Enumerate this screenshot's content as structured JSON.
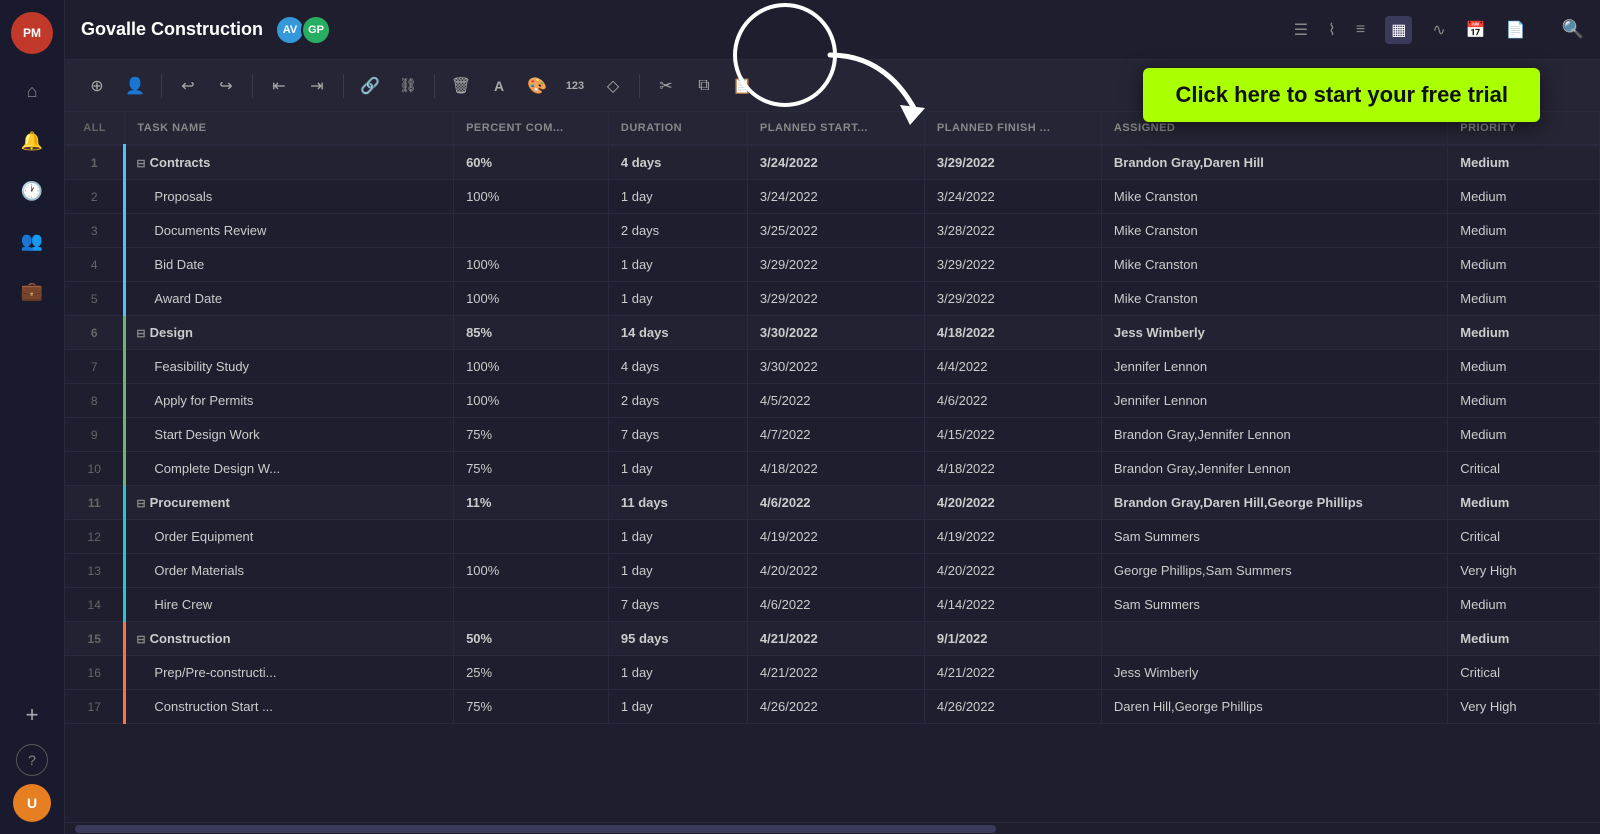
{
  "app": {
    "logo_text": "PM",
    "title": "Govalle Construction",
    "avatar1_text": "AV",
    "avatar2_text": "GP",
    "search_icon": "🔍",
    "free_trial_text": "Click here to start your free trial"
  },
  "sidebar": {
    "items": [
      {
        "id": "home",
        "icon": "⌂",
        "label": "Home"
      },
      {
        "id": "notifications",
        "icon": "🔔",
        "label": "Notifications"
      },
      {
        "id": "time",
        "icon": "🕐",
        "label": "Time"
      },
      {
        "id": "team",
        "icon": "👥",
        "label": "Team"
      },
      {
        "id": "portfolio",
        "icon": "💼",
        "label": "Portfolio"
      },
      {
        "id": "add",
        "icon": "+",
        "label": "Add"
      },
      {
        "id": "help",
        "icon": "?",
        "label": "Help"
      }
    ]
  },
  "toolbar": {
    "buttons": [
      {
        "id": "add-task",
        "icon": "⊕",
        "label": "Add Task"
      },
      {
        "id": "add-person",
        "icon": "👤",
        "label": "Add Person"
      },
      {
        "id": "undo",
        "icon": "↩",
        "label": "Undo"
      },
      {
        "id": "redo",
        "icon": "↪",
        "label": "Redo"
      },
      {
        "id": "indent-left",
        "icon": "⇤",
        "label": "Indent Left"
      },
      {
        "id": "indent-right",
        "icon": "⇥",
        "label": "Indent Right"
      },
      {
        "id": "link",
        "icon": "🔗",
        "label": "Link"
      },
      {
        "id": "unlink",
        "icon": "⛓",
        "label": "Unlink"
      },
      {
        "id": "delete",
        "icon": "🗑",
        "label": "Delete"
      },
      {
        "id": "font",
        "icon": "A",
        "label": "Font"
      },
      {
        "id": "color",
        "icon": "🎨",
        "label": "Color"
      },
      {
        "id": "number",
        "icon": "123",
        "label": "Number"
      },
      {
        "id": "shape",
        "icon": "◇",
        "label": "Shape"
      },
      {
        "id": "cut",
        "icon": "✂",
        "label": "Cut"
      },
      {
        "id": "copy",
        "icon": "⧉",
        "label": "Copy"
      },
      {
        "id": "paste",
        "icon": "📋",
        "label": "Paste"
      }
    ]
  },
  "table": {
    "headers": [
      {
        "id": "all",
        "label": "ALL"
      },
      {
        "id": "task-name",
        "label": "TASK NAME"
      },
      {
        "id": "percent",
        "label": "PERCENT COM..."
      },
      {
        "id": "duration",
        "label": "DURATION"
      },
      {
        "id": "planned-start",
        "label": "PLANNED START..."
      },
      {
        "id": "planned-finish",
        "label": "PLANNED FINISH ..."
      },
      {
        "id": "assigned",
        "label": "ASSIGNED"
      },
      {
        "id": "priority",
        "label": "PRIORITY"
      }
    ],
    "rows": [
      {
        "num": 1,
        "type": "group",
        "color": "blue",
        "name": "Contracts",
        "percent": "60%",
        "duration": "4 days",
        "start": "3/24/2022",
        "finish": "3/29/2022",
        "assigned": "Brandon Gray,Daren Hill",
        "priority": "Medium"
      },
      {
        "num": 2,
        "type": "task",
        "color": "blue",
        "name": "Proposals",
        "percent": "100%",
        "duration": "1 day",
        "start": "3/24/2022",
        "finish": "3/24/2022",
        "assigned": "Mike Cranston",
        "priority": "Medium"
      },
      {
        "num": 3,
        "type": "task",
        "color": "blue",
        "name": "Documents Review",
        "percent": "",
        "duration": "2 days",
        "start": "3/25/2022",
        "finish": "3/28/2022",
        "assigned": "Mike Cranston",
        "priority": "Medium"
      },
      {
        "num": 4,
        "type": "task",
        "color": "blue",
        "name": "Bid Date",
        "percent": "100%",
        "duration": "1 day",
        "start": "3/29/2022",
        "finish": "3/29/2022",
        "assigned": "Mike Cranston",
        "priority": "Medium"
      },
      {
        "num": 5,
        "type": "task",
        "color": "blue",
        "name": "Award Date",
        "percent": "100%",
        "duration": "1 day",
        "start": "3/29/2022",
        "finish": "3/29/2022",
        "assigned": "Mike Cranston",
        "priority": "Medium"
      },
      {
        "num": 6,
        "type": "group",
        "color": "green",
        "name": "Design",
        "percent": "85%",
        "duration": "14 days",
        "start": "3/30/2022",
        "finish": "4/18/2022",
        "assigned": "Jess Wimberly",
        "priority": "Medium"
      },
      {
        "num": 7,
        "type": "task",
        "color": "green",
        "name": "Feasibility Study",
        "percent": "100%",
        "duration": "4 days",
        "start": "3/30/2022",
        "finish": "4/4/2022",
        "assigned": "Jennifer Lennon",
        "priority": "Medium"
      },
      {
        "num": 8,
        "type": "task",
        "color": "green",
        "name": "Apply for Permits",
        "percent": "100%",
        "duration": "2 days",
        "start": "4/5/2022",
        "finish": "4/6/2022",
        "assigned": "Jennifer Lennon",
        "priority": "Medium"
      },
      {
        "num": 9,
        "type": "task",
        "color": "green",
        "name": "Start Design Work",
        "percent": "75%",
        "duration": "7 days",
        "start": "4/7/2022",
        "finish": "4/15/2022",
        "assigned": "Brandon Gray,Jennifer Lennon",
        "priority": "Medium"
      },
      {
        "num": 10,
        "type": "task",
        "color": "green",
        "name": "Complete Design W...",
        "percent": "75%",
        "duration": "1 day",
        "start": "4/18/2022",
        "finish": "4/18/2022",
        "assigned": "Brandon Gray,Jennifer Lennon",
        "priority": "Critical"
      },
      {
        "num": 11,
        "type": "group",
        "color": "teal",
        "name": "Procurement",
        "percent": "11%",
        "duration": "11 days",
        "start": "4/6/2022",
        "finish": "4/20/2022",
        "assigned": "Brandon Gray,Daren Hill,George Phillips",
        "priority": "Medium"
      },
      {
        "num": 12,
        "type": "task",
        "color": "teal",
        "name": "Order Equipment",
        "percent": "",
        "duration": "1 day",
        "start": "4/19/2022",
        "finish": "4/19/2022",
        "assigned": "Sam Summers",
        "priority": "Critical"
      },
      {
        "num": 13,
        "type": "task",
        "color": "teal",
        "name": "Order Materials",
        "percent": "100%",
        "duration": "1 day",
        "start": "4/20/2022",
        "finish": "4/20/2022",
        "assigned": "George Phillips,Sam Summers",
        "priority": "Very High"
      },
      {
        "num": 14,
        "type": "task",
        "color": "teal",
        "name": "Hire Crew",
        "percent": "",
        "duration": "7 days",
        "start": "4/6/2022",
        "finish": "4/14/2022",
        "assigned": "Sam Summers",
        "priority": "Medium"
      },
      {
        "num": 15,
        "type": "group",
        "color": "orange",
        "name": "Construction",
        "percent": "50%",
        "duration": "95 days",
        "start": "4/21/2022",
        "finish": "9/1/2022",
        "assigned": "",
        "priority": "Medium"
      },
      {
        "num": 16,
        "type": "task",
        "color": "orange",
        "name": "Prep/Pre-constructi...",
        "percent": "25%",
        "duration": "1 day",
        "start": "4/21/2022",
        "finish": "4/21/2022",
        "assigned": "Jess Wimberly",
        "priority": "Critical"
      },
      {
        "num": 17,
        "type": "task",
        "color": "orange",
        "name": "Construction Start ...",
        "percent": "75%",
        "duration": "1 day",
        "start": "4/26/2022",
        "finish": "4/26/2022",
        "assigned": "Daren Hill,George Phillips",
        "priority": "Very High"
      }
    ]
  }
}
